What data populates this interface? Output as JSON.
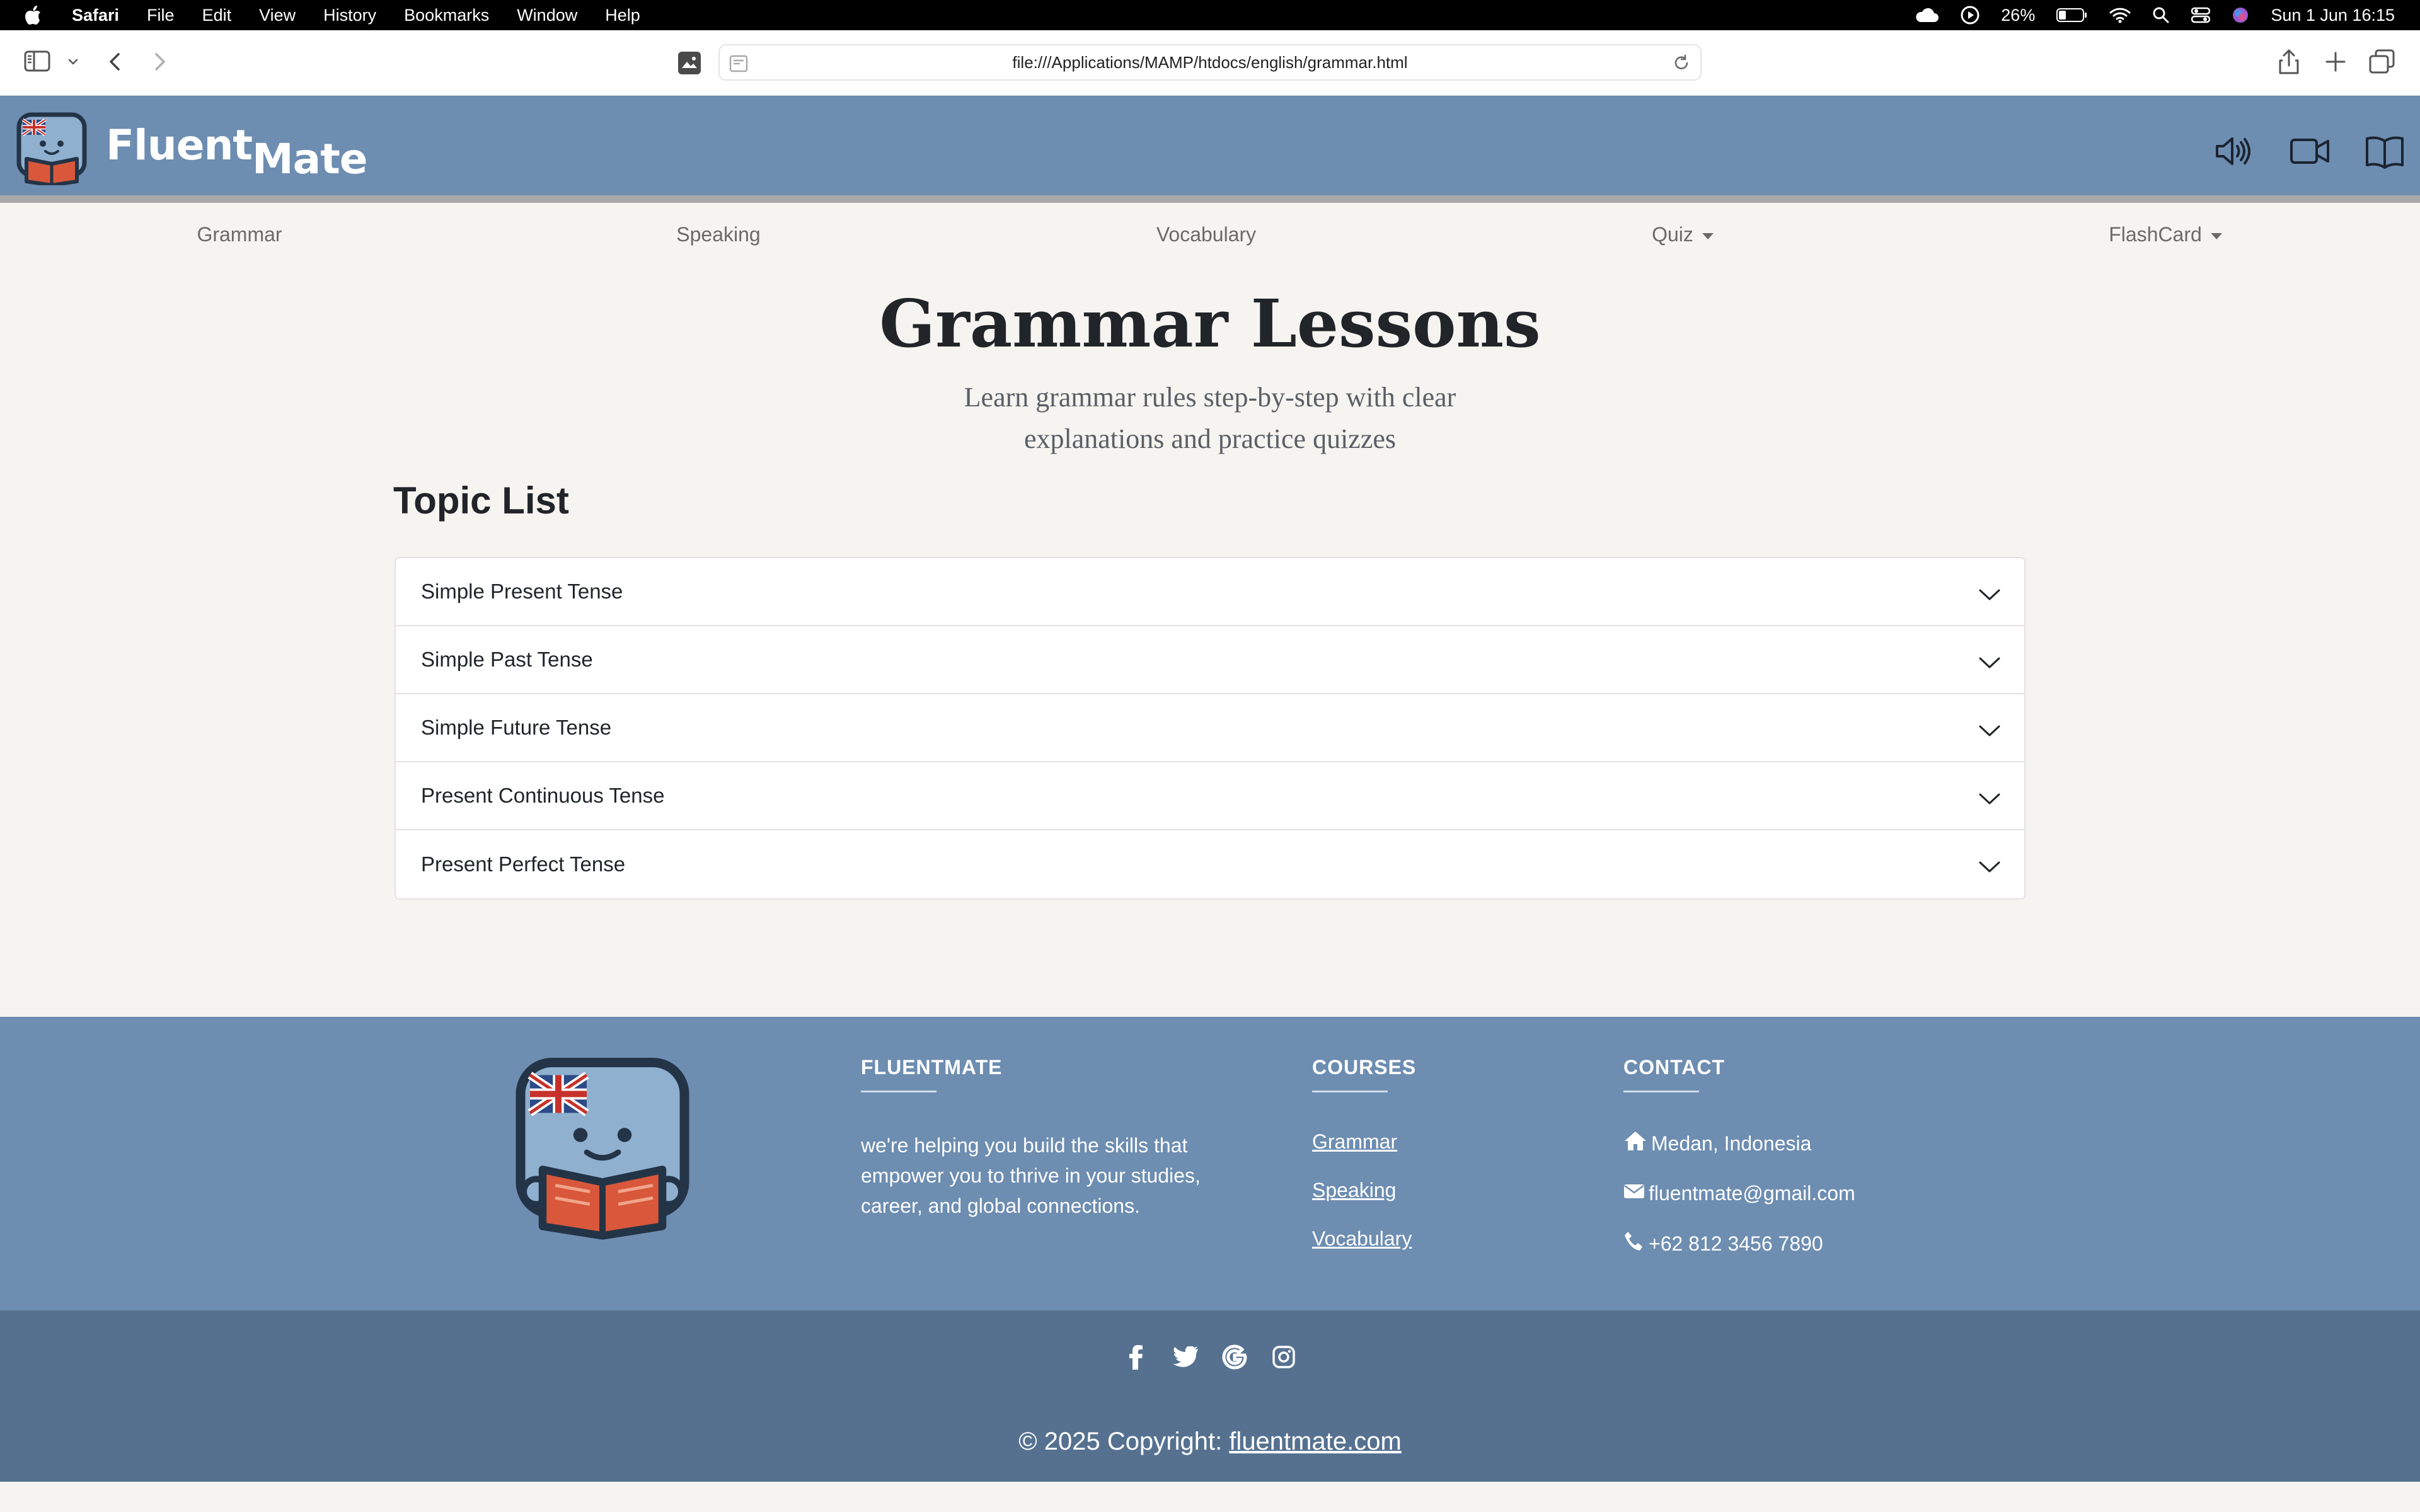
{
  "menubar": {
    "app": "Safari",
    "items": [
      "File",
      "Edit",
      "View",
      "History",
      "Bookmarks",
      "Window",
      "Help"
    ],
    "battery": "26%",
    "datetime": "Sun 1 Jun  16:15"
  },
  "browser": {
    "url": "file:///Applications/MAMP/htdocs/english/grammar.html"
  },
  "site": {
    "logo_word1": "Fluent",
    "logo_word2": "Mate",
    "header_icons": [
      "speaker-icon",
      "video-icon",
      "book-icon"
    ]
  },
  "nav": {
    "items": [
      {
        "label": "Grammar",
        "dropdown": false
      },
      {
        "label": "Speaking",
        "dropdown": false
      },
      {
        "label": "Vocabulary",
        "dropdown": false
      },
      {
        "label": "Quiz",
        "dropdown": true
      },
      {
        "label": "FlashCard",
        "dropdown": true
      }
    ]
  },
  "hero": {
    "title": "Grammar Lessons",
    "subtitle_line1": "Learn grammar rules step-by-step with clear",
    "subtitle_line2": "explanations and practice quizzes"
  },
  "topics": {
    "heading": "Topic List",
    "items": [
      "Simple Present Tense",
      "Simple Past Tense",
      "Simple Future Tense",
      "Present Continuous Tense",
      "Present Perfect Tense"
    ]
  },
  "footer": {
    "about_heading": "FLUENTMATE",
    "about_text": "we're helping you build the skills that empower you to thrive in your studies, career, and global connections.",
    "courses_heading": "COURSES",
    "courses": [
      "Grammar",
      "Speaking",
      "Vocabulary"
    ],
    "contact_heading": "CONTACT",
    "address": "Medan, Indonesia",
    "email": "fluentmate@gmail.com",
    "phone": "+62 812 3456 7890",
    "socials": [
      "facebook-icon",
      "twitter-icon",
      "google-icon",
      "instagram-icon"
    ],
    "copyright_prefix": "© 2025 Copyright: ",
    "copyright_link": "fluentmate.com"
  },
  "colors": {
    "brand_blue": "#6d8db1",
    "footer_dark": "#567190",
    "page_bg": "#f6f4f0"
  }
}
